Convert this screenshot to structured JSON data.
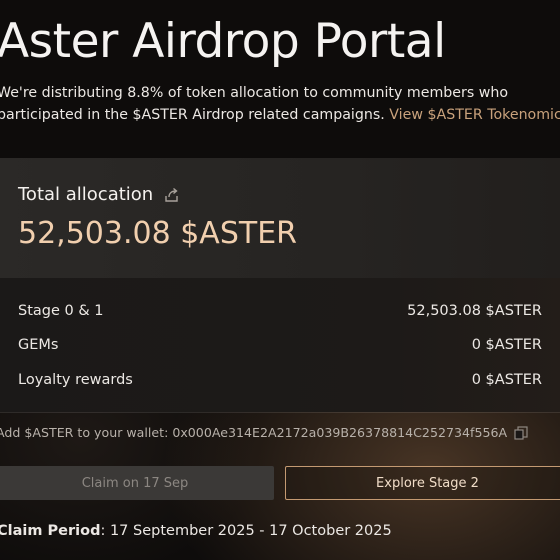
{
  "header": {
    "title": "Aster Airdrop Portal",
    "intro_text": "We're distributing 8.8% of token allocation to community members who participated in the $ASTER Airdrop related campaigns.",
    "intro_link": "View $ASTER Tokenomics"
  },
  "allocation": {
    "label": "Total allocation",
    "share_icon": "share-icon",
    "total": "52,503.08 $ASTER",
    "rows": [
      {
        "label": "Stage 0 & 1",
        "value": "52,503.08 $ASTER"
      },
      {
        "label": "GEMs",
        "value": "0 $ASTER"
      },
      {
        "label": "Loyalty rewards",
        "value": "0 $ASTER"
      }
    ]
  },
  "wallet": {
    "text": "Add $ASTER to your wallet: 0x000Ae314E2A2172a039B26378814C252734f556A",
    "copy_icon": "copy-icon"
  },
  "buttons": {
    "claim": "Claim on 17 Sep",
    "explore": "Explore Stage 2"
  },
  "claim_period": {
    "label": "Claim Period",
    "value": ": 17 September 2025 - 17 October 2025"
  },
  "colors": {
    "accent": "#f1cfae",
    "link": "#c9a27c",
    "button_border": "#c49a72",
    "disabled_button": "#3b3937"
  }
}
